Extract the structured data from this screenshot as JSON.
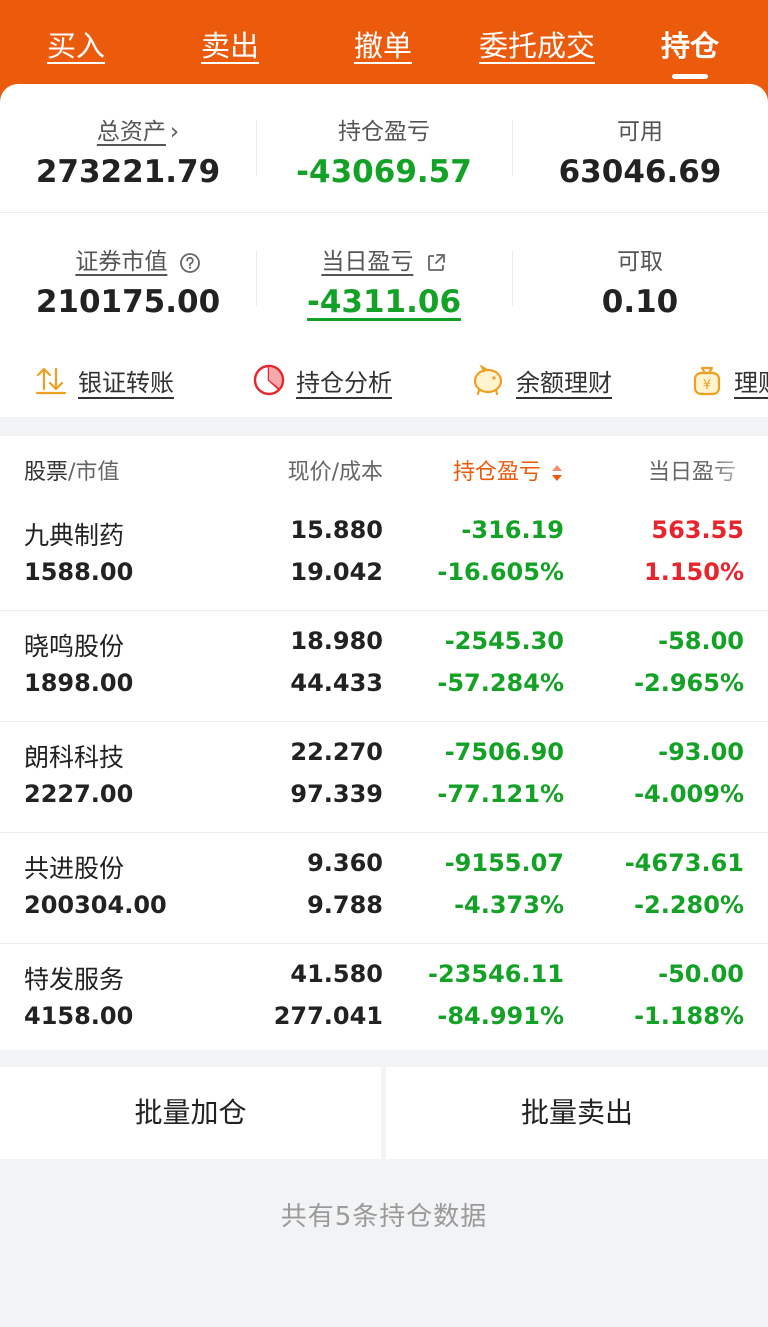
{
  "tabs": [
    {
      "label": "买入",
      "active": false
    },
    {
      "label": "卖出",
      "active": false
    },
    {
      "label": "撤单",
      "active": false
    },
    {
      "label": "委托成交",
      "active": false
    },
    {
      "label": "持仓",
      "active": true
    }
  ],
  "summary": {
    "total_assets": {
      "label": "总资产",
      "value": "273221.79"
    },
    "position_pnl": {
      "label": "持仓盈亏",
      "value": "-43069.57"
    },
    "available": {
      "label": "可用",
      "value": "63046.69"
    },
    "market_value": {
      "label": "证券市值",
      "value": "210175.00"
    },
    "daily_pnl": {
      "label": "当日盈亏",
      "value": "-4311.06"
    },
    "withdrawable": {
      "label": "可取",
      "value": "0.10"
    }
  },
  "shortcuts": [
    {
      "label": "银证转账",
      "icon": "transfer-icon"
    },
    {
      "label": "持仓分析",
      "icon": "pie-chart-icon"
    },
    {
      "label": "余额理财",
      "icon": "piggy-bank-icon"
    },
    {
      "label": "理财",
      "icon": "money-bag-icon"
    }
  ],
  "table": {
    "headers": {
      "stock": "股票",
      "market_value": "/市值",
      "price_cost": "现价/成本",
      "position_pnl": "持仓盈亏",
      "daily_pnl": "当日盈亏"
    },
    "rows": [
      {
        "name": "九典制药",
        "market_value": "1588.00",
        "price": "15.880",
        "cost": "19.042",
        "pnl": "-316.19",
        "pnl_pct": "-16.605%",
        "day_pnl": "563.55",
        "day_pct": "1.150%",
        "day_color": "red"
      },
      {
        "name": "晓鸣股份",
        "market_value": "1898.00",
        "price": "18.980",
        "cost": "44.433",
        "pnl": "-2545.30",
        "pnl_pct": "-57.284%",
        "day_pnl": "-58.00",
        "day_pct": "-2.965%",
        "day_color": "green"
      },
      {
        "name": "朗科科技",
        "market_value": "2227.00",
        "price": "22.270",
        "cost": "97.339",
        "pnl": "-7506.90",
        "pnl_pct": "-77.121%",
        "day_pnl": "-93.00",
        "day_pct": "-4.009%",
        "day_color": "green"
      },
      {
        "name": "共进股份",
        "market_value": "200304.00",
        "price": "9.360",
        "cost": "9.788",
        "pnl": "-9155.07",
        "pnl_pct": "-4.373%",
        "day_pnl": "-4673.61",
        "day_pct": "-2.280%",
        "day_color": "green"
      },
      {
        "name": "特发服务",
        "market_value": "4158.00",
        "price": "41.580",
        "cost": "277.041",
        "pnl": "-23546.11",
        "pnl_pct": "-84.991%",
        "day_pnl": "-50.00",
        "day_pct": "-1.188%",
        "day_color": "green"
      }
    ]
  },
  "actions": {
    "batch_add": "批量加仓",
    "batch_sell": "批量卖出"
  },
  "footer_note": "共有5条持仓数据",
  "colors": {
    "brand": "#ec5a0c",
    "up": "#e8242c",
    "down": "#13a225"
  }
}
